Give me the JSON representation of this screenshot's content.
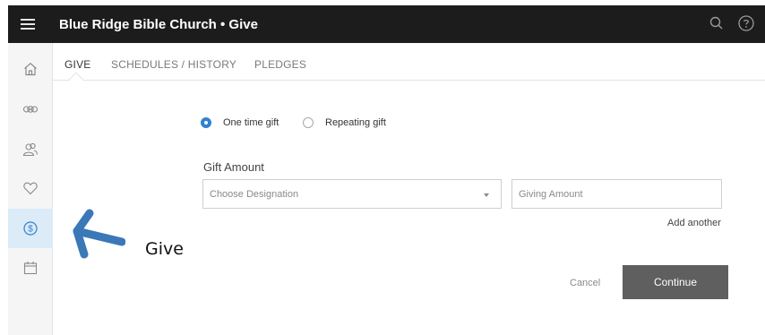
{
  "header": {
    "title": "Blue Ridge Bible Church • Give"
  },
  "icons": {
    "menu": "hamburger-icon",
    "search": "search-icon",
    "help": "help-icon"
  },
  "sidebar": {
    "items": [
      {
        "icon": "home-icon",
        "active": false
      },
      {
        "icon": "groups-icon",
        "active": false
      },
      {
        "icon": "people-icon",
        "active": false
      },
      {
        "icon": "heart-icon",
        "active": false
      },
      {
        "icon": "dollar-icon",
        "active": true
      },
      {
        "icon": "calendar-icon",
        "active": false
      }
    ]
  },
  "tabs": [
    {
      "label": "GIVE",
      "active": true
    },
    {
      "label": "SCHEDULES / HISTORY",
      "active": false
    },
    {
      "label": "PLEDGES",
      "active": false
    }
  ],
  "gift_type": {
    "options": [
      {
        "label": "One time gift",
        "checked": true
      },
      {
        "label": "Repeating gift",
        "checked": false
      }
    ]
  },
  "gift_amount": {
    "label": "Gift Amount",
    "designation_placeholder": "Choose Designation",
    "amount_placeholder": "Giving Amount",
    "add_another": "Add another"
  },
  "actions": {
    "cancel": "Cancel",
    "continue": "Continue"
  },
  "annotation": {
    "label": "Give"
  },
  "colors": {
    "topbar": "#1c1c1c",
    "accent": "#2f82cf",
    "active_nav": "#dcebf8",
    "continue_button": "#5f5f5f",
    "annotation_arrow": "#3a78b8"
  }
}
